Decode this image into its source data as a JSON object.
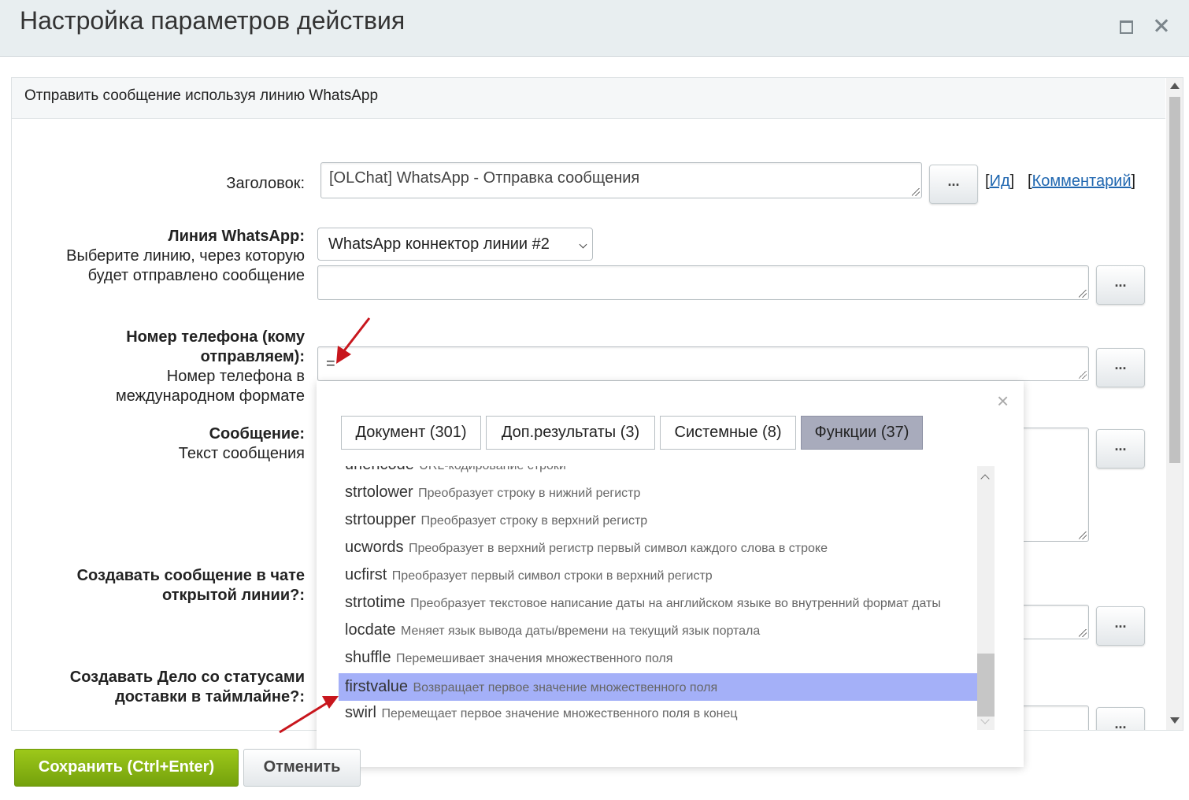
{
  "window": {
    "title": "Настройка параметров действия"
  },
  "section": {
    "title": "Отправить сообщение используя линию WhatsApp"
  },
  "fields": {
    "header_label": "Заголовок:",
    "header_value": "[OLChat] WhatsApp - Отправка сообщения",
    "id_link": "Ид",
    "comment_link": "Комментарий",
    "line_label": "Линия WhatsApp:",
    "line_hint": "Выберите линию, через которую будет отправлено сообщение",
    "line_select": "WhatsApp коннектор линии #2",
    "phone_label": "Номер телефона (кому отправляем):",
    "phone_hint": "Номер телефона в международном формате",
    "phone_value": "=",
    "message_label": "Сообщение:",
    "message_hint": "Текст сообщения",
    "chat_label": "Создавать сообщение в чате открытой линии?:",
    "deal_label": "Создавать Дело со статусами доставки в таймлайне?:",
    "dots": "..."
  },
  "popup": {
    "close": "×",
    "tabs": [
      "Документ (301)",
      "Доп.результаты (3)",
      "Системные (8)",
      "Функции (37)"
    ],
    "active_tab": "Функции (37)",
    "items": [
      {
        "name": "urlencode",
        "desc": "URL-кодирование строки"
      },
      {
        "name": "strtolower",
        "desc": "Преобразует строку в нижний регистр"
      },
      {
        "name": "strtoupper",
        "desc": "Преобразует строку в верхний регистр"
      },
      {
        "name": "ucwords",
        "desc": "Преобразует в верхний регистр первый символ каждого слова в строке"
      },
      {
        "name": "ucfirst",
        "desc": "Преобразует первый символ строки в верхний регистр"
      },
      {
        "name": "strtotime",
        "desc": "Преобразует текстовое написание даты на английском языке во внутренний формат даты"
      },
      {
        "name": "locdate",
        "desc": "Меняет язык вывода даты/времени на текущий язык портала"
      },
      {
        "name": "shuffle",
        "desc": "Перемешивает значения множественного поля"
      },
      {
        "name": "firstvalue",
        "desc": "Возвращает первое значение множественного поля"
      },
      {
        "name": "swirl",
        "desc": "Перемещает первое значение множественного поля в конец"
      }
    ],
    "selected_item": "firstvalue"
  },
  "buttons": {
    "save": "Сохранить (Ctrl+Enter)",
    "cancel": "Отменить"
  },
  "colors": {
    "accent_green": "#84b312",
    "selected_row": "#a4b0f8",
    "active_tab": "#a8abbc",
    "annotation_arrow": "#c8161d"
  }
}
